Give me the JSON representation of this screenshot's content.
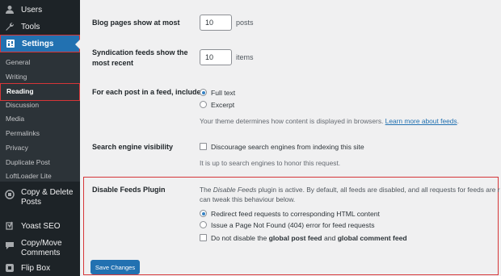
{
  "sidebar": {
    "items": [
      {
        "label": "Users",
        "icon": "users-icon"
      },
      {
        "label": "Tools",
        "icon": "wrench-icon"
      },
      {
        "label": "Settings",
        "icon": "settings-icon"
      }
    ],
    "submenu": [
      "General",
      "Writing",
      "Reading",
      "Discussion",
      "Media",
      "Permalinks",
      "Privacy",
      "Duplicate Post",
      "LoftLoader Lite"
    ],
    "plugins": [
      {
        "label_line1": "Copy & Delete",
        "label_line2": "Posts",
        "icon": "copy-icon"
      },
      {
        "label": "Yoast SEO",
        "icon": "yoast-icon"
      },
      {
        "label_line1": "Copy/Move",
        "label_line2": "Comments",
        "icon": "comments-icon"
      },
      {
        "label": "Flip Box",
        "icon": "flipbox-icon"
      }
    ]
  },
  "settings": {
    "blog_pages": {
      "label": "Blog pages show at most",
      "value": "10",
      "suffix": "posts"
    },
    "syndication": {
      "label_line1": "Syndication feeds show the",
      "label_line2": "most recent",
      "value": "10",
      "suffix": "items"
    },
    "feed_content": {
      "label": "For each post in a feed, include",
      "options": [
        "Full text",
        "Excerpt"
      ],
      "selected": "Full text",
      "description": "Your theme determines how content is displayed in browsers.",
      "link": "Learn more about feeds"
    },
    "search_visibility": {
      "label": "Search engine visibility",
      "checkbox_label": "Discourage search engines from indexing this site",
      "checked": false,
      "description": "It is up to search engines to honor this request."
    },
    "disable_feeds": {
      "label": "Disable Feeds Plugin",
      "desc_prefix": "The ",
      "desc_plugin": "Disable Feeds",
      "desc_rest": " plugin is active. By default, all feeds are disabled, and all requests for feeds are r",
      "desc_line2": "can tweak this behaviour below.",
      "options": [
        "Redirect feed requests to corresponding HTML content",
        "Issue a Page Not Found (404) error for feed requests"
      ],
      "selected": "Redirect feed requests to corresponding HTML content",
      "checkbox_prefix": "Do not disable the ",
      "checkbox_bold1": "global post feed",
      "checkbox_mid": " and ",
      "checkbox_bold2": "global comment feed",
      "checked": false
    }
  },
  "save_label": "Save Changes",
  "colors": {
    "accent": "#2271b1",
    "sidebar_bg": "#1d2327",
    "highlight": "#d63638"
  }
}
